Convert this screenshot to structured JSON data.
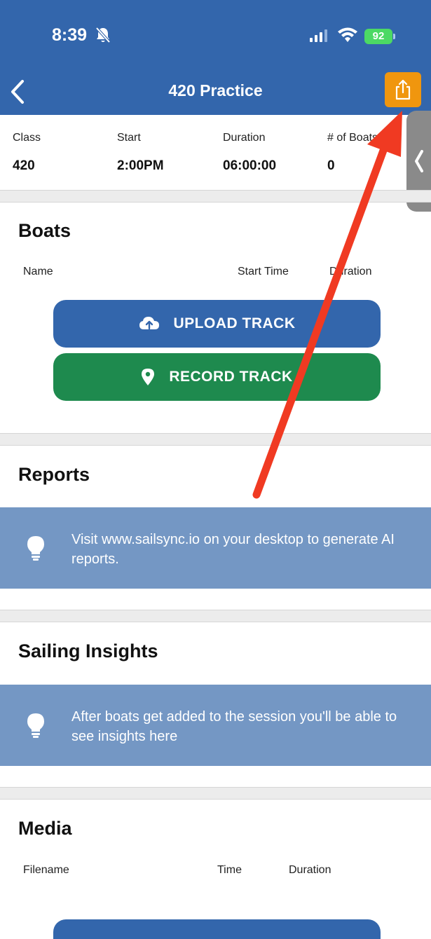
{
  "status_bar": {
    "time": "8:39",
    "battery": "92"
  },
  "nav": {
    "title": "420 Practice"
  },
  "info": [
    {
      "label": "Class",
      "value": "420"
    },
    {
      "label": "Start",
      "value": "2:00PM"
    },
    {
      "label": "Duration",
      "value": "06:00:00"
    },
    {
      "label": "# of Boats",
      "value": "0"
    }
  ],
  "boats": {
    "title": "Boats",
    "columns": [
      "Name",
      "Start Time",
      "Duration"
    ],
    "upload_label": "UPLOAD TRACK",
    "record_label": "RECORD TRACK"
  },
  "reports": {
    "title": "Reports",
    "tip": "Visit www.sailsync.io on your desktop to generate AI reports."
  },
  "insights": {
    "title": "Sailing Insights",
    "tip": "After boats get added to the session you'll be able to see insights here"
  },
  "media": {
    "title": "Media",
    "columns": [
      "Filename",
      "Time",
      "Duration"
    ]
  },
  "colors": {
    "header": "#3366ac",
    "share": "#f0960e",
    "upload": "#3366ac",
    "record": "#1e8a4e",
    "tip": "#7497c4",
    "annotation": "#f03a22"
  }
}
